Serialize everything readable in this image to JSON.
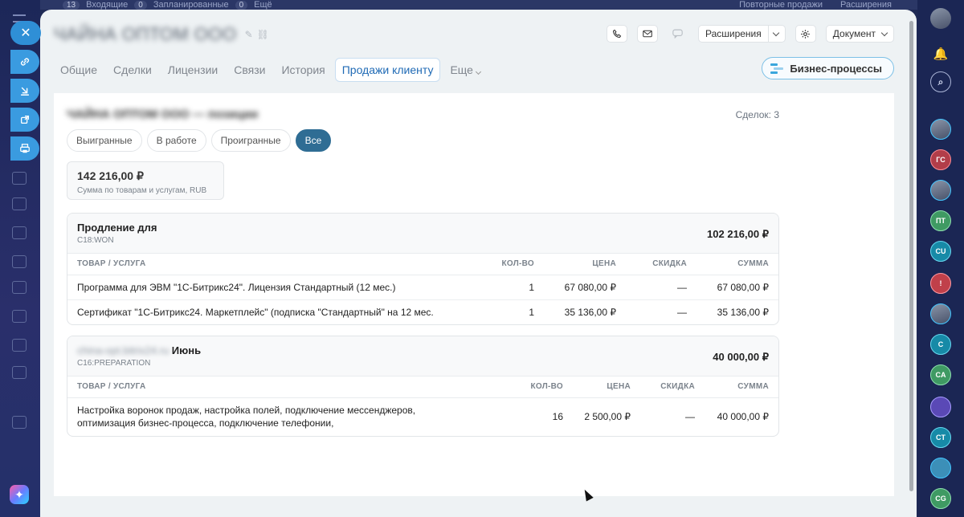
{
  "background": {
    "top_items": [
      {
        "count": "13",
        "label": "Входящие"
      },
      {
        "count": "0",
        "label": "Запланированные"
      },
      {
        "count": "0",
        "label": "Ещё"
      }
    ],
    "right_items": [
      "Повторные продажи",
      "Расширения"
    ]
  },
  "entity": {
    "title": "ЧАЙНА ОПТОМ ООО"
  },
  "toolbar": {
    "extensions_label": "Расширения",
    "document_label": "Документ"
  },
  "tabs": [
    {
      "label": "Общие"
    },
    {
      "label": "Сделки"
    },
    {
      "label": "Лицензии"
    },
    {
      "label": "Связи"
    },
    {
      "label": "История"
    },
    {
      "label": "Продажи клиенту"
    },
    {
      "label": "Еще"
    }
  ],
  "business_processes_label": "Бизнес-процессы",
  "sales": {
    "section_title": "ЧАЙНА ОПТОМ ООО — позиции",
    "deals_count": "Сделок: 3",
    "filters": [
      "Выигранные",
      "В работе",
      "Проигранные",
      "Все"
    ],
    "active_filter": "Все",
    "summary": {
      "amount": "142 216,00 ₽",
      "caption": "Сумма по товарам и услугам, RUB"
    },
    "deals": [
      {
        "name_visible": "Продление для",
        "name_blurred": "",
        "stage": "C18:WON",
        "total": "102 216,00 ₽",
        "columns": [
          "ТОВАР / УСЛУГА",
          "КОЛ-ВО",
          "ЦЕНА",
          "СКИДКА",
          "СУММА"
        ],
        "rows": [
          [
            "Программа для ЭВМ \"1С-Битрикс24\". Лицензия Стандартный (12 мес.)",
            "1",
            "67 080,00 ₽",
            "—",
            "67 080,00 ₽"
          ],
          [
            "Сертификат \"1С-Битрикс24. Маркетплейс\" (подписка \"Стандартный\" на 12 мес.",
            "1",
            "35 136,00 ₽",
            "—",
            "35 136,00 ₽"
          ]
        ]
      },
      {
        "name_visible": "Июнь",
        "name_blurred": "china-opt.bitrix24.ru",
        "stage": "C16:PREPARATION",
        "total": "40 000,00 ₽",
        "columns": [
          "ТОВАР / УСЛУГА",
          "КОЛ-ВО",
          "ЦЕНА",
          "СКИДКА",
          "СУММА"
        ],
        "rows": [
          [
            "Настройка воронок продаж, настройка полей, подключение мессенджеров, оптимизация бизнес-процесса, подключение телефонии,",
            "16",
            "2 500,00 ₽",
            "—",
            "40 000,00 ₽"
          ]
        ]
      }
    ]
  },
  "right_avatars": [
    "",
    "",
    "",
    "ГС",
    "",
    "ПТ",
    "CU",
    "!",
    "",
    "С",
    "CA",
    "",
    "CT",
    "",
    "CG"
  ],
  "icons": {
    "close": "close-icon",
    "link": "link-icon",
    "download": "download-icon",
    "open": "external-link-icon",
    "print": "print-icon",
    "phone": "phone-icon",
    "mail": "mail-icon",
    "chat": "chat-icon",
    "settings": "gear-icon"
  }
}
